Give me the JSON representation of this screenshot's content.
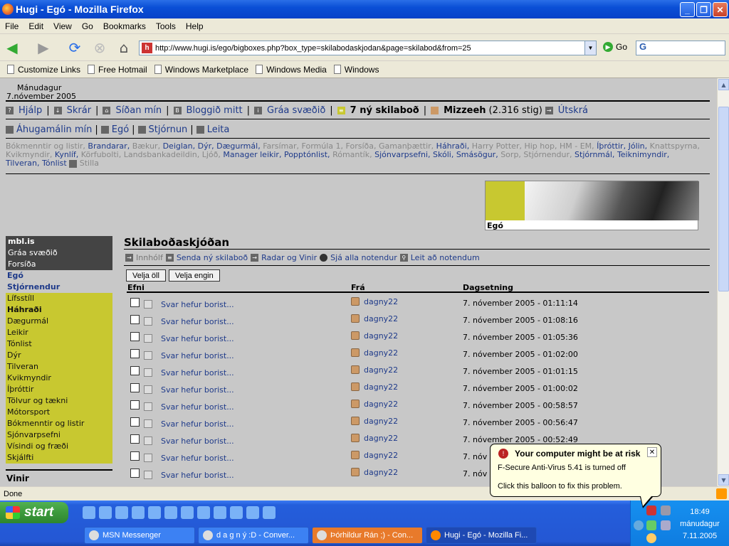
{
  "window": {
    "title": "Hugi - Egó - Mozilla Firefox"
  },
  "menu": [
    "File",
    "Edit",
    "View",
    "Go",
    "Bookmarks",
    "Tools",
    "Help"
  ],
  "nav": {
    "url": "http://www.hugi.is/ego/bigboxes.php?box_type=skilabodaskjodan&page=skilabod&from=25",
    "go_label": "Go",
    "search_logo": "G"
  },
  "bookmarks": [
    "Customize Links",
    "Free Hotmail",
    "Windows Marketplace",
    "Windows Media",
    "Windows"
  ],
  "page": {
    "day": "Mánudagur",
    "date": "7.nóvember 2005",
    "topnav": {
      "help": "Hjálp",
      "files": "Skrár",
      "mypage": "Síðan mín",
      "blog": "Bloggið mitt",
      "grey": "Gráa svæðið",
      "messages": "7 ný skilaboð",
      "user": "Mizzeeh",
      "points": "(2.316 stig)",
      "logout": "Útskrá"
    },
    "secnav": {
      "interests": "Áhugamálin mín",
      "ego": "Egó",
      "admin": "Stjórnun",
      "search": "Leita"
    },
    "tags_line1": [
      "Bókmenntir og listir,",
      "Brandarar,",
      "Bækur,",
      "Deiglan,",
      "Dýr,",
      "Dægurmál,",
      "Farsímar,",
      "Formúla 1,",
      "Forsíða,",
      "Gamanþættir,",
      "Háhraði,",
      "Harry Potter,",
      "Hip hop,",
      "HM - EM,",
      "Íþróttir,",
      "Jólin,",
      "Knattspyrna,"
    ],
    "tags_line2": [
      "Kvikmyndir,",
      "Kynlíf,",
      "Körfubolti,",
      "Landsbankadeildin,",
      "Ljóð,",
      "Manager leikir,",
      "Popptónlist,",
      "Rómantík,",
      "Sjónvarpsefni,",
      "Skóli,",
      "Smásögur,",
      "Sorp,",
      "Stjórnendur,",
      "Stjórnmál,",
      "Teiknimyndir,"
    ],
    "tags_line3": [
      "Tilveran,",
      "Tónlist"
    ],
    "tags_edit": "Stilla",
    "banner_label": "Egó",
    "sidebar": {
      "dark": [
        "mbl.is",
        "Gráa svæðið",
        "Forsíða"
      ],
      "grey": [
        "Egó",
        "Stjórnendur"
      ],
      "yellow": [
        "Lífsstíll",
        "Háhraði",
        "Dægurmál",
        "Leikir",
        "Tónlist",
        "Dýr",
        "Tilveran",
        "Kvikmyndir",
        "Íþróttir",
        "Tölvur og tækni",
        "Mótorsport",
        "Bókmenntir og listir",
        "Sjónvarpsefni",
        "Vísindi og fræði",
        "Skjálfti"
      ],
      "vinir": "Vinir"
    },
    "content": {
      "title": "Skilaboðaskjóðan",
      "sub": {
        "inbox": "Innhólf",
        "send": "Senda ný skilaboð",
        "radar": "Radar og Vinir",
        "users": "Sjá alla notendur",
        "search": "Leit að notendum"
      },
      "select_all": "Velja öll",
      "select_none": "Velja engin",
      "columns": {
        "subject": "Efni",
        "from": "Frá",
        "date": "Dagsetning"
      },
      "rows": [
        {
          "subject": "Svar hefur borist...",
          "from": "dagny22",
          "date": "7. nóvember 2005 - 01:11:14"
        },
        {
          "subject": "Svar hefur borist...",
          "from": "dagny22",
          "date": "7. nóvember 2005 - 01:08:16"
        },
        {
          "subject": "Svar hefur borist...",
          "from": "dagny22",
          "date": "7. nóvember 2005 - 01:05:36"
        },
        {
          "subject": "Svar hefur borist...",
          "from": "dagny22",
          "date": "7. nóvember 2005 - 01:02:00"
        },
        {
          "subject": "Svar hefur borist...",
          "from": "dagny22",
          "date": "7. nóvember 2005 - 01:01:15"
        },
        {
          "subject": "Svar hefur borist...",
          "from": "dagny22",
          "date": "7. nóvember 2005 - 01:00:02"
        },
        {
          "subject": "Svar hefur borist...",
          "from": "dagny22",
          "date": "7. nóvember 2005 - 00:58:57"
        },
        {
          "subject": "Svar hefur borist...",
          "from": "dagny22",
          "date": "7. nóvember 2005 - 00:56:47"
        },
        {
          "subject": "Svar hefur borist...",
          "from": "dagny22",
          "date": "7. nóvember 2005 - 00:52:49"
        },
        {
          "subject": "Svar hefur borist...",
          "from": "dagny22",
          "date": "7. nóv"
        },
        {
          "subject": "Svar hefur borist...",
          "from": "dagny22",
          "date": "7. nóv"
        }
      ]
    }
  },
  "status": {
    "text": "Done"
  },
  "balloon": {
    "title": "Your computer might be at risk",
    "line1": "F-Secure Anti-Virus 5.41 is turned off",
    "line2": "Click this balloon to fix this problem."
  },
  "taskbar": {
    "start": "start",
    "tasks": [
      "MSN Messenger",
      "d a g n ý :D - Conver...",
      "Þórhildur Rán ;) - Con...",
      "Hugi - Egó - Mozilla Fi..."
    ],
    "clock": {
      "time": "18:49",
      "day": "mánudagur",
      "date": "7.11.2005"
    }
  }
}
